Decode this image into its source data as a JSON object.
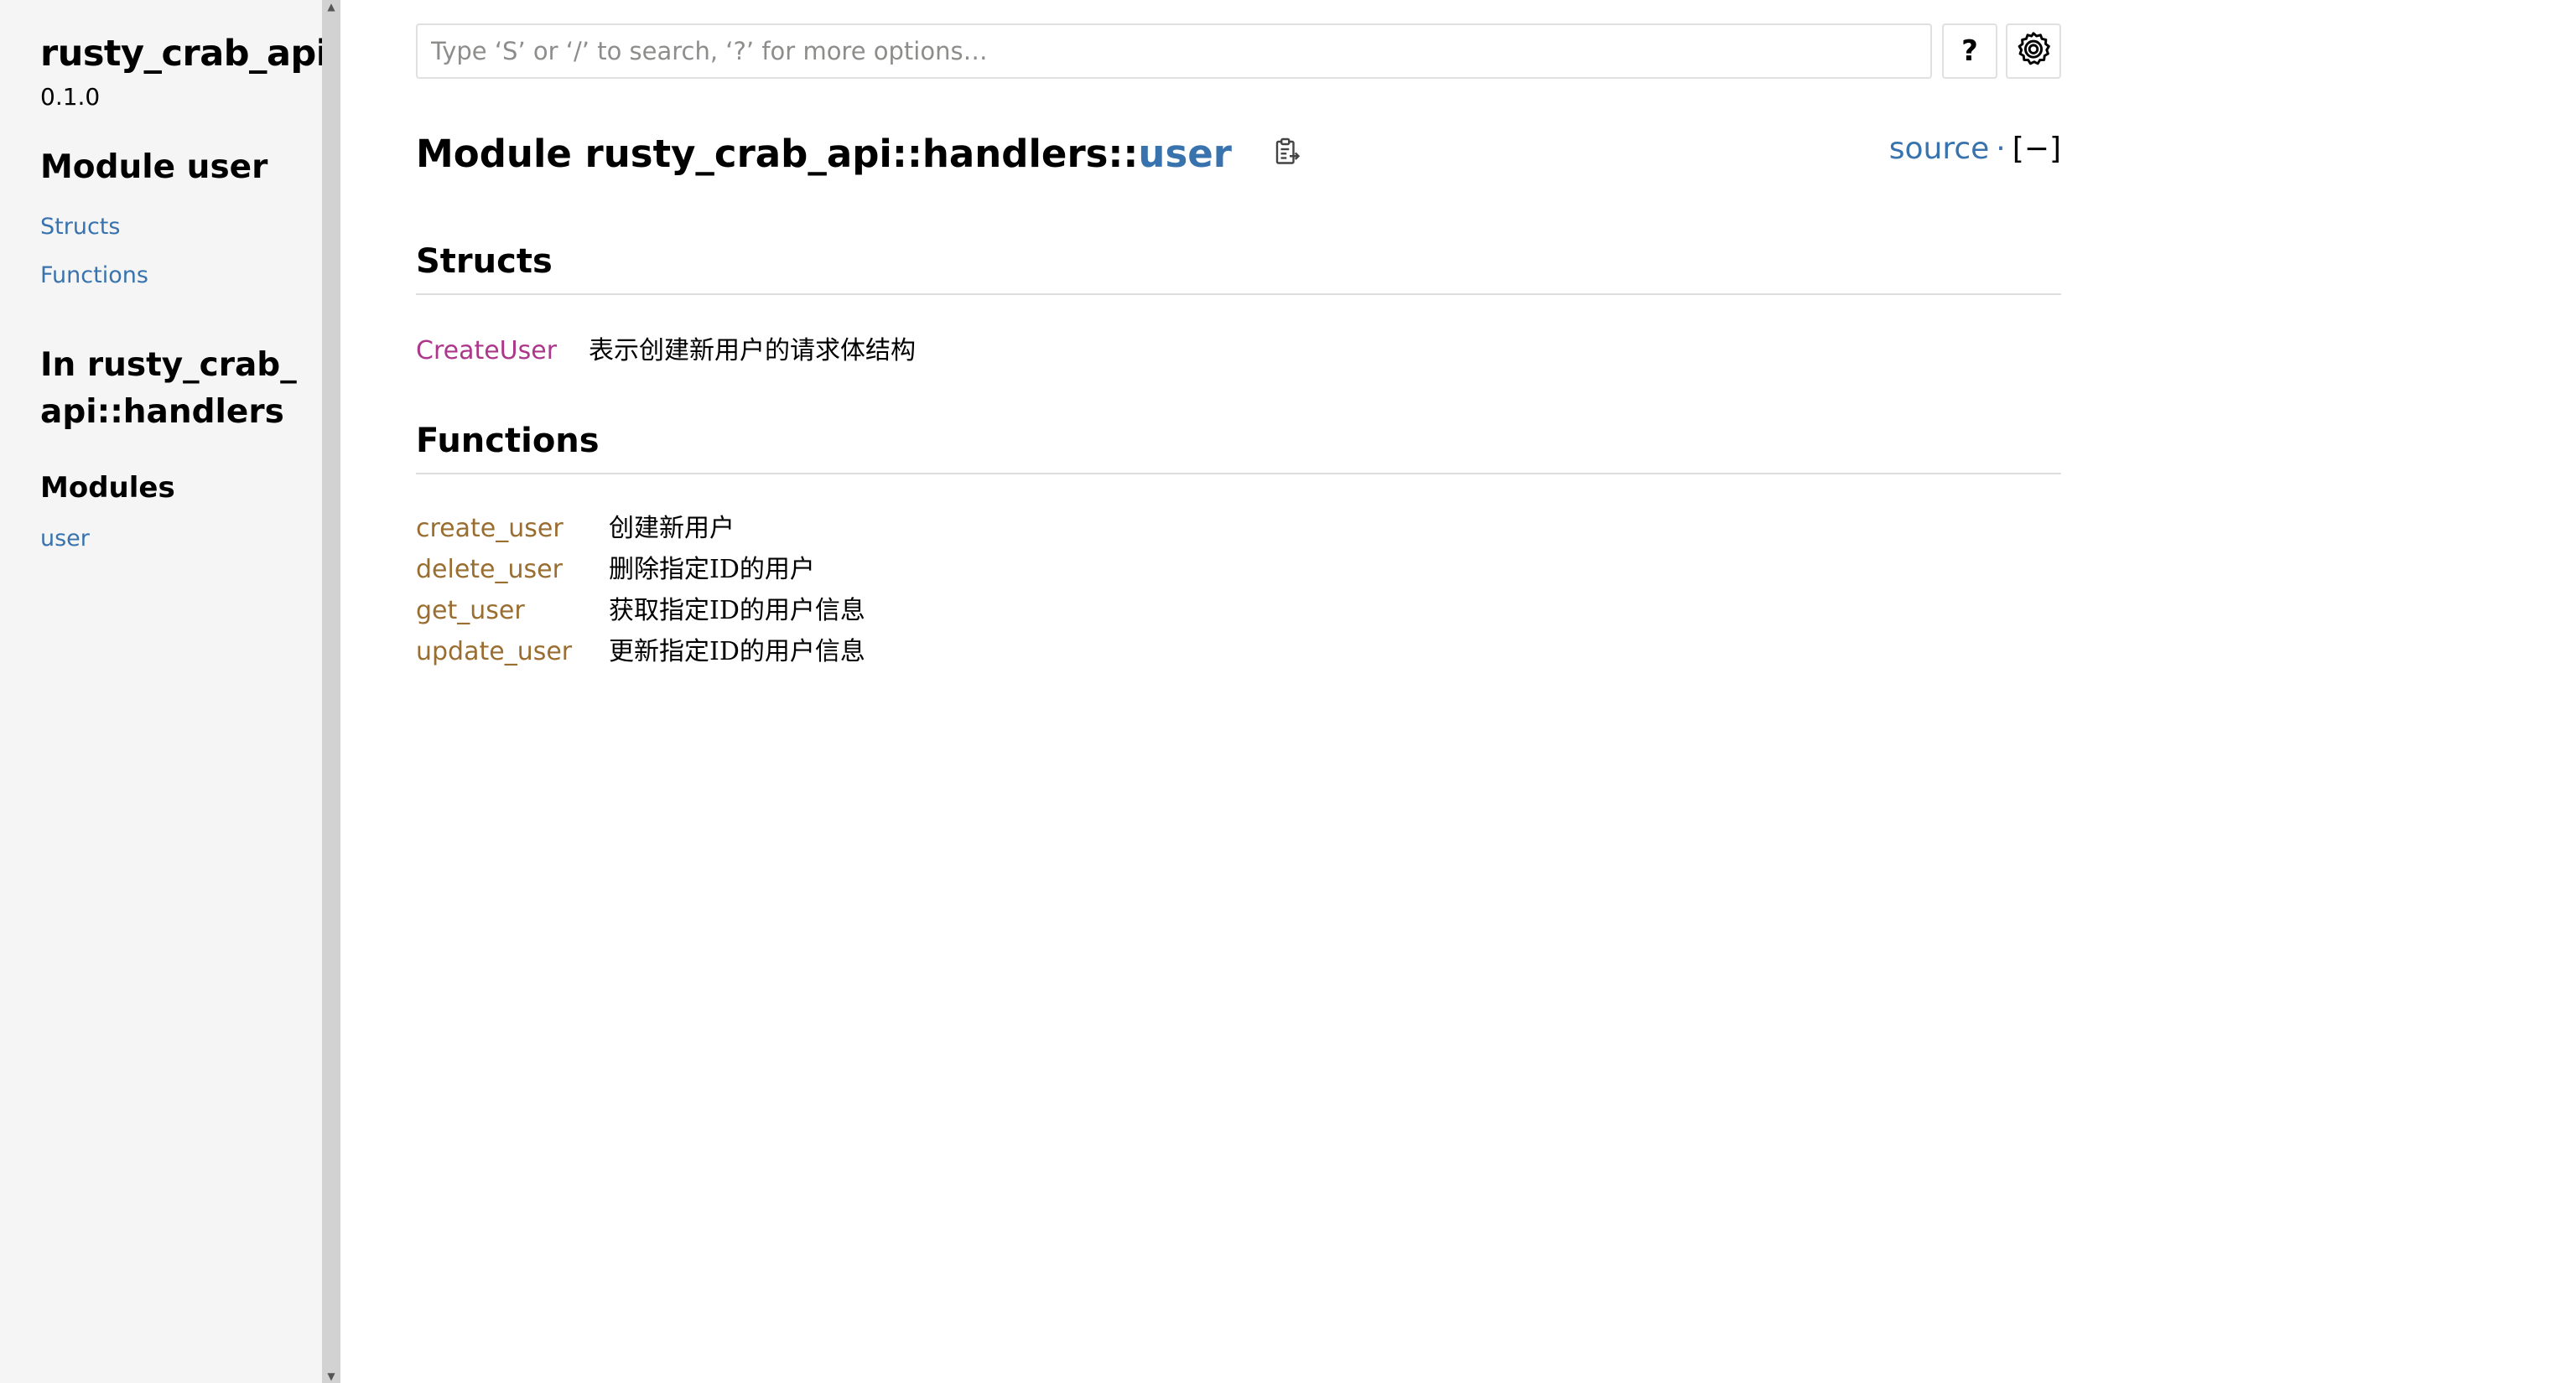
{
  "sidebar": {
    "crate_name": "rusty_crab_api",
    "version": "0.1.0",
    "module_title": "Module user",
    "section_links": [
      "Structs",
      "Functions"
    ],
    "parent_title": "In rusty_crab_api::handlers",
    "modules_heading": "Modules",
    "module_links": [
      "user"
    ]
  },
  "search": {
    "placeholder": "Type ‘S’ or ‘/’ to search, ‘?’ for more options…"
  },
  "toolbar": {
    "help_label": "?",
    "settings_icon": "gear-icon"
  },
  "heading": {
    "prefix": "Module rusty_crab_api::handlers::",
    "module_name": "user",
    "copy_icon": "clipboard-icon",
    "source_label": "source",
    "separator": "·",
    "toggle_label": "[−]"
  },
  "structs": {
    "title": "Structs",
    "items": [
      {
        "name": "CreateUser",
        "desc": "表示创建新用户的请求体结构"
      }
    ]
  },
  "functions": {
    "title": "Functions",
    "items": [
      {
        "name": "create_user",
        "desc": "创建新用户"
      },
      {
        "name": "delete_user",
        "desc": "删除指定ID的用户"
      },
      {
        "name": "get_user",
        "desc": "获取指定ID的用户信息"
      },
      {
        "name": "update_user",
        "desc": "更新指定ID的用户信息"
      }
    ]
  },
  "colors": {
    "link": "#3873ad",
    "struct": "#ad378a",
    "function": "#9a6e31",
    "sidebar_bg": "#f5f5f5"
  }
}
